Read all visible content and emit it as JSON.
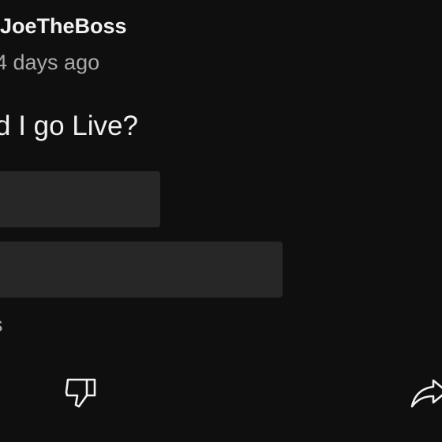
{
  "post": {
    "author": "JoeTheBoss",
    "timestamp": "4 days ago",
    "question": "d I go Live?"
  },
  "poll": {
    "options": [
      {
        "label": ""
      },
      {
        "label": ""
      }
    ],
    "vote_count": "s"
  },
  "actions": {
    "dislike_icon": "thumbs-down-icon",
    "share_icon": "share-arrow-icon"
  },
  "colors": {
    "background": "#0f0f0f",
    "text_primary": "#f1f1f1",
    "text_secondary": "#aaaaaa",
    "option_fill": "#272727"
  }
}
